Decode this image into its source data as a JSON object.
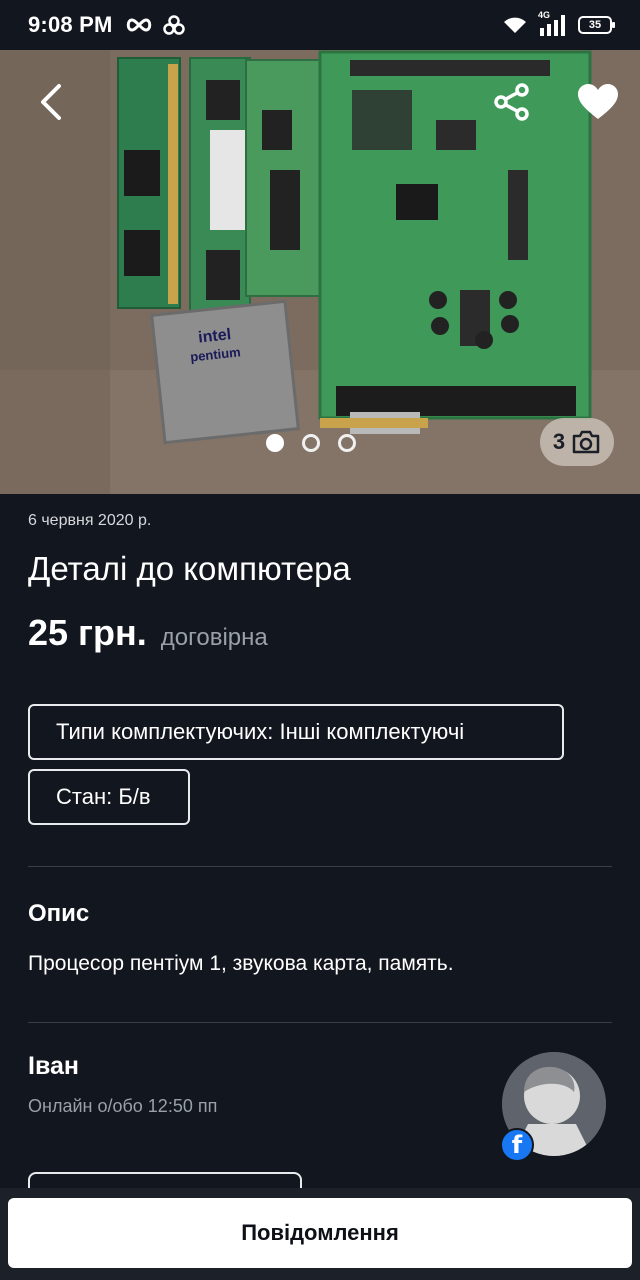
{
  "status_bar": {
    "time": "9:08 PM",
    "network_label": "4G",
    "battery_level": "35",
    "icons": [
      "infinity-icon",
      "flower-icon",
      "wifi-icon",
      "signal-icon",
      "battery-icon"
    ]
  },
  "gallery": {
    "photo_count": "3",
    "total_images": 3,
    "active_index": 0,
    "description_icons": [
      "arrow-left-icon",
      "share-icon",
      "heart-icon",
      "camera-icon"
    ]
  },
  "listing": {
    "date": "6 червня 2020 р.",
    "title": "Деталі до компютера",
    "price": "25 грн.",
    "price_note": "договірна",
    "params": [
      "Типи комплектуючих: Інші комплектуючі",
      "Стан: Б/в"
    ]
  },
  "description": {
    "heading": "Опис",
    "text": "Процесор пентіум 1, звукова карта, память."
  },
  "seller": {
    "name": "Іван",
    "status": "Онлайн о/обо 12:50 пп",
    "badge": "f"
  },
  "actions": {
    "message_label": "Повідомлення"
  },
  "colors": {
    "background": "#12161e",
    "button_bg": "#ffffff",
    "facebook": "#1877f2"
  }
}
